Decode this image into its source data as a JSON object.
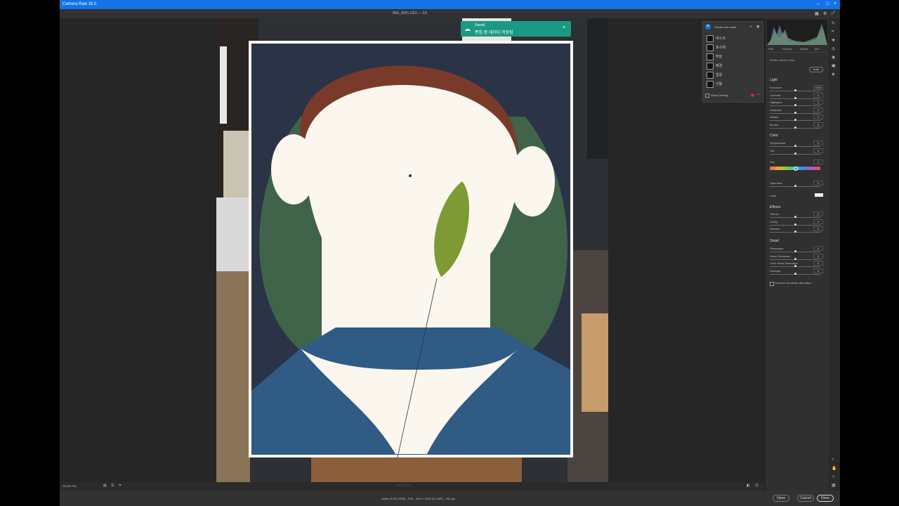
{
  "window": {
    "title": "Camera Raw 16.0"
  },
  "document": {
    "name": "IMG_0001.CR2 — 2/2"
  },
  "toast": {
    "line1": "Saved",
    "line2": "편집 중 데이터 저장됨"
  },
  "masks": {
    "header": "Create new mask",
    "items": [
      {
        "label": "마스크"
      },
      {
        "label": "피사체"
      },
      {
        "label": "하늘"
      },
      {
        "label": "배경"
      },
      {
        "label": "얼굴"
      },
      {
        "label": "인물"
      }
    ],
    "footer": "Show Overlay"
  },
  "right_panel": {
    "tabs": [
      "Edit",
      "Presets",
      "Masks",
      "Info"
    ],
    "profile_label": "Profile: Adobe Color",
    "auto_label": "Auto",
    "sections": {
      "light": "Light",
      "color": "Color",
      "effects": "Effects",
      "detail": "Detail",
      "optics": "Remove chromatic aberration"
    },
    "light_params": [
      {
        "label": "Exposure",
        "value": "0.00",
        "pos": 0.5
      },
      {
        "label": "Contrast",
        "value": "0",
        "pos": 0.5
      },
      {
        "label": "Highlights",
        "value": "0",
        "pos": 0.5
      },
      {
        "label": "Shadows",
        "value": "0",
        "pos": 0.5
      },
      {
        "label": "Whites",
        "value": "0",
        "pos": 0.5
      },
      {
        "label": "Blacks",
        "value": "0",
        "pos": 0.5
      }
    ],
    "color_params": [
      {
        "label": "Temperature",
        "value": "0",
        "pos": 0.5
      },
      {
        "label": "Tint",
        "value": "0",
        "pos": 0.5
      }
    ],
    "hue": {
      "label": "Hue",
      "value": "0",
      "pos": 0.5
    },
    "saturation": {
      "label": "Saturation",
      "value": "0",
      "pos": 0.5
    },
    "color_swatch": {
      "label": "Color"
    },
    "effects_params": [
      {
        "label": "Texture",
        "value": "0",
        "pos": 0.5
      },
      {
        "label": "Clarity",
        "value": "0",
        "pos": 0.5
      },
      {
        "label": "Dehaze",
        "value": "0",
        "pos": 0.5
      }
    ],
    "detail_params": [
      {
        "label": "Sharpness",
        "value": "0",
        "pos": 0.5
      },
      {
        "label": "Noise Reduction",
        "value": "0",
        "pos": 0.5
      },
      {
        "label": "Color Noise Reduction",
        "value": "0",
        "pos": 0.5
      },
      {
        "label": "Defringe",
        "value": "0",
        "pos": 0.5
      }
    ]
  },
  "bottom": {
    "zoom": "Fit (15.7%)",
    "status": "Adobe RGB (1998) - 8 bit - 4000 x 6000 (24.0MP) - 300 ppi"
  },
  "buttons": {
    "open": "Open",
    "cancel": "Cancel",
    "done": "Done"
  },
  "colors": {
    "accent": "#1473e6",
    "toast": "#1b9a83"
  }
}
